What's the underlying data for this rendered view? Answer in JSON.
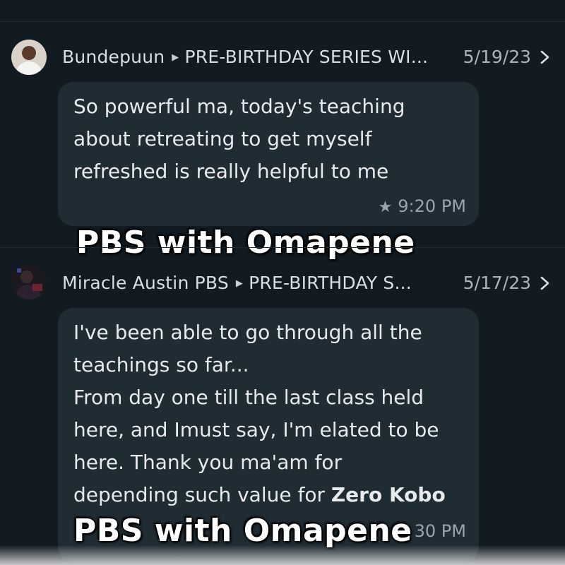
{
  "chats": [
    {
      "sender": "Bundepuun",
      "group": "PRE-BIRTHDAY SERIES WI...",
      "date": "5/19/23",
      "message_lines": [
        "So powerful ma, today's teaching",
        "about retreating to get myself",
        "refreshed is really helpful to me"
      ],
      "time": "9:20 PM",
      "starred": true,
      "avatar_icon": "avatar-photo-icon"
    },
    {
      "sender": "Miracle Austin PBS",
      "group": "PRE-BIRTHDAY S...",
      "date": "5/17/23",
      "message_lines": [
        "I've been able to go through all the",
        "teachings so far...",
        "From day one till the last class held",
        "here, and Imust say,  I'm elated to be",
        "here. Thank you ma'am for"
      ],
      "message_last_plain": "depending such value for ",
      "message_last_bold": "Zero Kobo",
      "time": "30 PM",
      "avatar_icon": "avatar-photo-icon"
    }
  ],
  "watermark": "PBS with Omapene",
  "colors": {
    "background": "#121b22",
    "bubble": "#202c33",
    "text": "#e6eaec",
    "meta": "#9aa5ab"
  },
  "icons": {
    "arrow": "play-arrow-icon",
    "chevron": "chevron-right-icon",
    "star": "star-icon"
  }
}
